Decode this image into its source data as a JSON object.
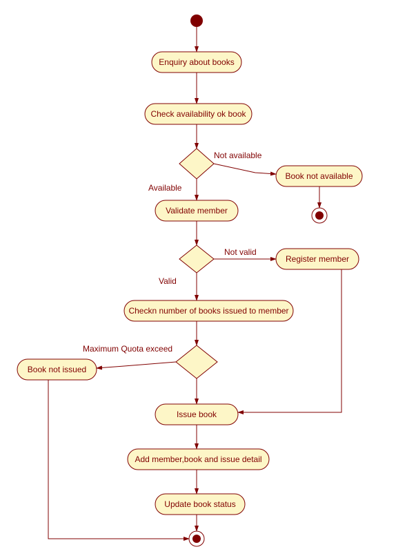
{
  "nodes": {
    "enquiry": "Enquiry about books",
    "check_avail": "Check availability ok book",
    "book_not_avail": "Book not available",
    "validate_member": "Validate member",
    "register_member": "Register member",
    "check_issued": "Checkn number of books issued to member",
    "book_not_issued": "Book not issued",
    "issue_book": "Issue book",
    "add_detail": "Add member,book and issue detail",
    "update_status": "Update book status"
  },
  "edges": {
    "not_available": "Not available",
    "available": "Available",
    "not_valid": "Not valid",
    "valid": "Valid",
    "quota_exceed": "Maximum Quota exceed"
  }
}
